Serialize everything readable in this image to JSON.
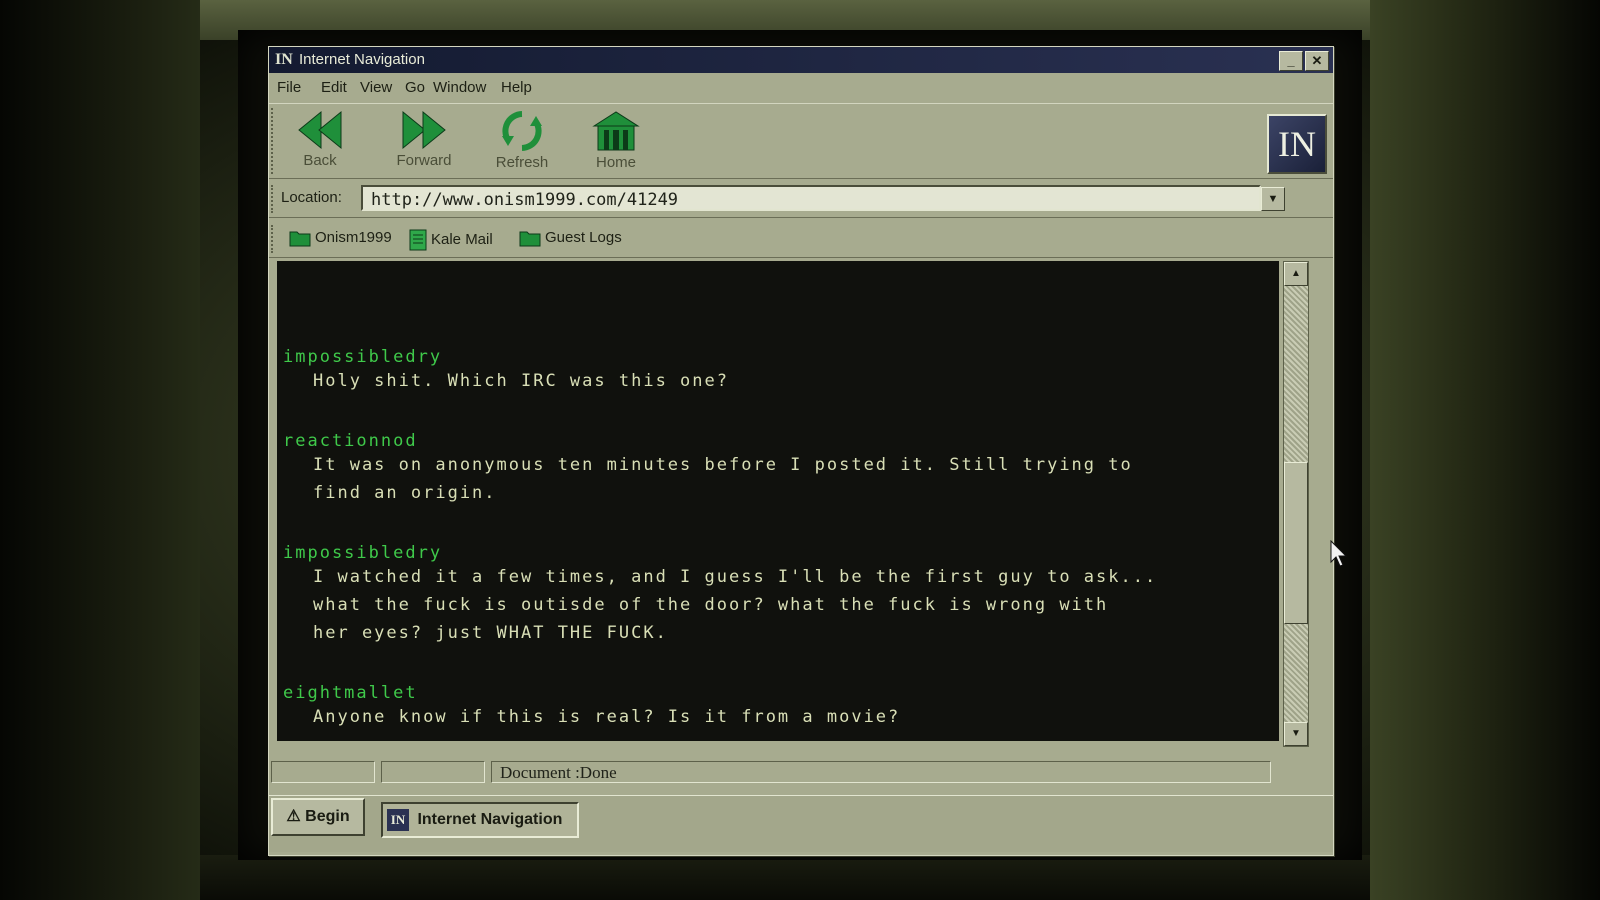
{
  "window": {
    "logo_text": "IN",
    "title": "Internet Navigation",
    "minimize_label": "_",
    "close_label": "✕"
  },
  "menu": [
    "File",
    "Edit",
    "View",
    "Go",
    "Window",
    "Help"
  ],
  "toolbar": {
    "back_label": "Back",
    "forward_label": "Forward",
    "refresh_label": "Refresh",
    "home_label": "Home",
    "brand_text": "IN"
  },
  "location": {
    "label": "Location:",
    "url": "http://www.onism1999.com/41249"
  },
  "bookmarks": [
    {
      "label": "Onism1999",
      "icon": "folder-icon"
    },
    {
      "label": "Kale Mail",
      "icon": "document-icon"
    },
    {
      "label": "Guest Logs",
      "icon": "folder-icon"
    }
  ],
  "posts": [
    {
      "user": "impossibledry",
      "lines": [
        "Holy shit. Which IRC was this one?"
      ]
    },
    {
      "user": "reactionnod",
      "lines": [
        "It was on anonymous ten minutes before I posted it. Still trying to",
        "find an origin."
      ]
    },
    {
      "user": "impossibledry",
      "lines": [
        "I watched it a few times, and I guess I'll be the first guy to ask...",
        "what the fuck is outisde of the door? what the fuck is wrong with",
        "her eyes? just WHAT THE FUCK."
      ]
    },
    {
      "user": "eightmallet",
      "lines": [
        "Anyone know if this is real? Is it from a movie?"
      ]
    }
  ],
  "status": {
    "pane1": "",
    "pane2": "",
    "text": "Document :Done"
  },
  "taskbar": {
    "begin_label": "Begin",
    "task_logo": "IN",
    "task_label": "Internet Navigation"
  },
  "colors": {
    "username": "#3fc94a",
    "message": "#d9dfb6",
    "icon_green": "#1f8f3a",
    "titlebar": "#131a30"
  }
}
